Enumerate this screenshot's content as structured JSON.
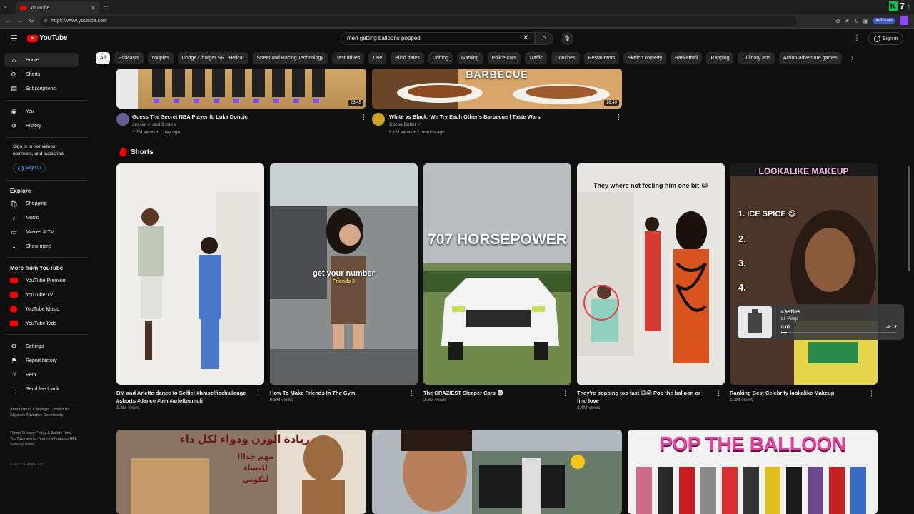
{
  "browser": {
    "tab_title": "YouTube",
    "url": "https://www.youtube.com",
    "incognito_label": "InPrivate"
  },
  "header": {
    "logo_text": "YouTube",
    "search_query": "men getting balloons popped",
    "signin": "Sign in"
  },
  "chips": [
    "All",
    "Podcasts",
    "couples",
    "Dodge Charger SRT Hellcat",
    "Street and Racing Technology",
    "Test drives",
    "Live",
    "Blind dates",
    "Drifting",
    "Gaming",
    "Police cars",
    "Traffic",
    "Couches",
    "Restaurants",
    "Sketch comedy",
    "Basketball",
    "Rapping",
    "Culinary arts",
    "Action-adventure games"
  ],
  "sidebar": {
    "main": [
      {
        "label": "Home",
        "icon": "home-icon"
      },
      {
        "label": "Shorts",
        "icon": "shorts-icon"
      },
      {
        "label": "Subscriptions",
        "icon": "subscriptions-icon"
      }
    ],
    "you": [
      {
        "label": "You",
        "icon": "you-icon"
      },
      {
        "label": "History",
        "icon": "history-icon"
      }
    ],
    "signin_prompt": "Sign in to like videos, comment, and subscribe.",
    "signin_button": "Sign in",
    "explore_heading": "Explore",
    "explore": [
      {
        "label": "Shopping",
        "icon": "shopping-icon"
      },
      {
        "label": "Music",
        "icon": "music-icon"
      },
      {
        "label": "Movies & TV",
        "icon": "movies-icon"
      },
      {
        "label": "Show more",
        "icon": "chevron-down-icon"
      }
    ],
    "more_heading": "More from YouTube",
    "more": [
      {
        "label": "YouTube Premium"
      },
      {
        "label": "YouTube TV"
      },
      {
        "label": "YouTube Music"
      },
      {
        "label": "YouTube Kids"
      }
    ],
    "settings": [
      {
        "label": "Settings",
        "icon": "gear-icon"
      },
      {
        "label": "Report history",
        "icon": "flag-icon"
      },
      {
        "label": "Help",
        "icon": "help-icon"
      },
      {
        "label": "Send feedback",
        "icon": "feedback-icon"
      }
    ],
    "footer1": "About  Press  Copyright  Contact us  Creators  Advertise  Developers",
    "footer2": "Terms  Privacy  Policy & Safety  How YouTube works  Test new features  NFL Sunday Ticket",
    "copyright": "© 2025 Google LLC"
  },
  "videos_top": [
    {
      "title": "Guess The Secret NBA Player ft. Luka Doncic",
      "channel": "Jesser ✓ and 2 more",
      "meta": "2.7M views • 1 day ago",
      "duration": "23:45"
    },
    {
      "title": "White vs Black: We Try Each Other's Barbecue | Taste Wars",
      "channel": "Cocoa Butter ✓",
      "meta": "6.2M views • 3 months ago",
      "duration": "16:49",
      "thumb_text": "BARBECUE"
    }
  ],
  "shorts_heading": "Shorts",
  "shorts": [
    {
      "title": "BM and Arlette dance to Selfie! #bmselfiechallenge #shorts #dance #bm #arletteamuli",
      "views": "1.3M views"
    },
    {
      "title": "How To Make Friends In The Gym",
      "views": "9.5M views",
      "overlay": "get your number",
      "overlay2": "Friends 3"
    },
    {
      "title": "The CRAZIEST Sleeper Cars 💀",
      "views": "2.3M views",
      "overlay": "707 HORSEPOWER"
    },
    {
      "title": "They're popping too fast 😩😱 Pop the balloon or find love",
      "views": "3.4M views",
      "overlay": "They where not feeling him one bit 😂"
    },
    {
      "title": "Ranking Best Celebrity lookalike Makeup",
      "views": "1.3M views",
      "overlay": "LOOKALIKE MAKEUP",
      "list": [
        "1. ICE SPICE 😋",
        "2.",
        "3.",
        "4."
      ]
    }
  ],
  "videos_bottom": [
    {
      "thumb_text": "زيادة الوزن ودواء لكل داء",
      "thumb_text2": "مهم جدااا للنساء لتكوني"
    },
    {
      "thumb_text": ""
    },
    {
      "thumb_text": "POP THE BALLOON"
    }
  ],
  "miniplayer": {
    "title": "castles",
    "artist": "Lil Peep",
    "current": "0:07",
    "remaining": "-2:17",
    "progress": 0.05
  }
}
